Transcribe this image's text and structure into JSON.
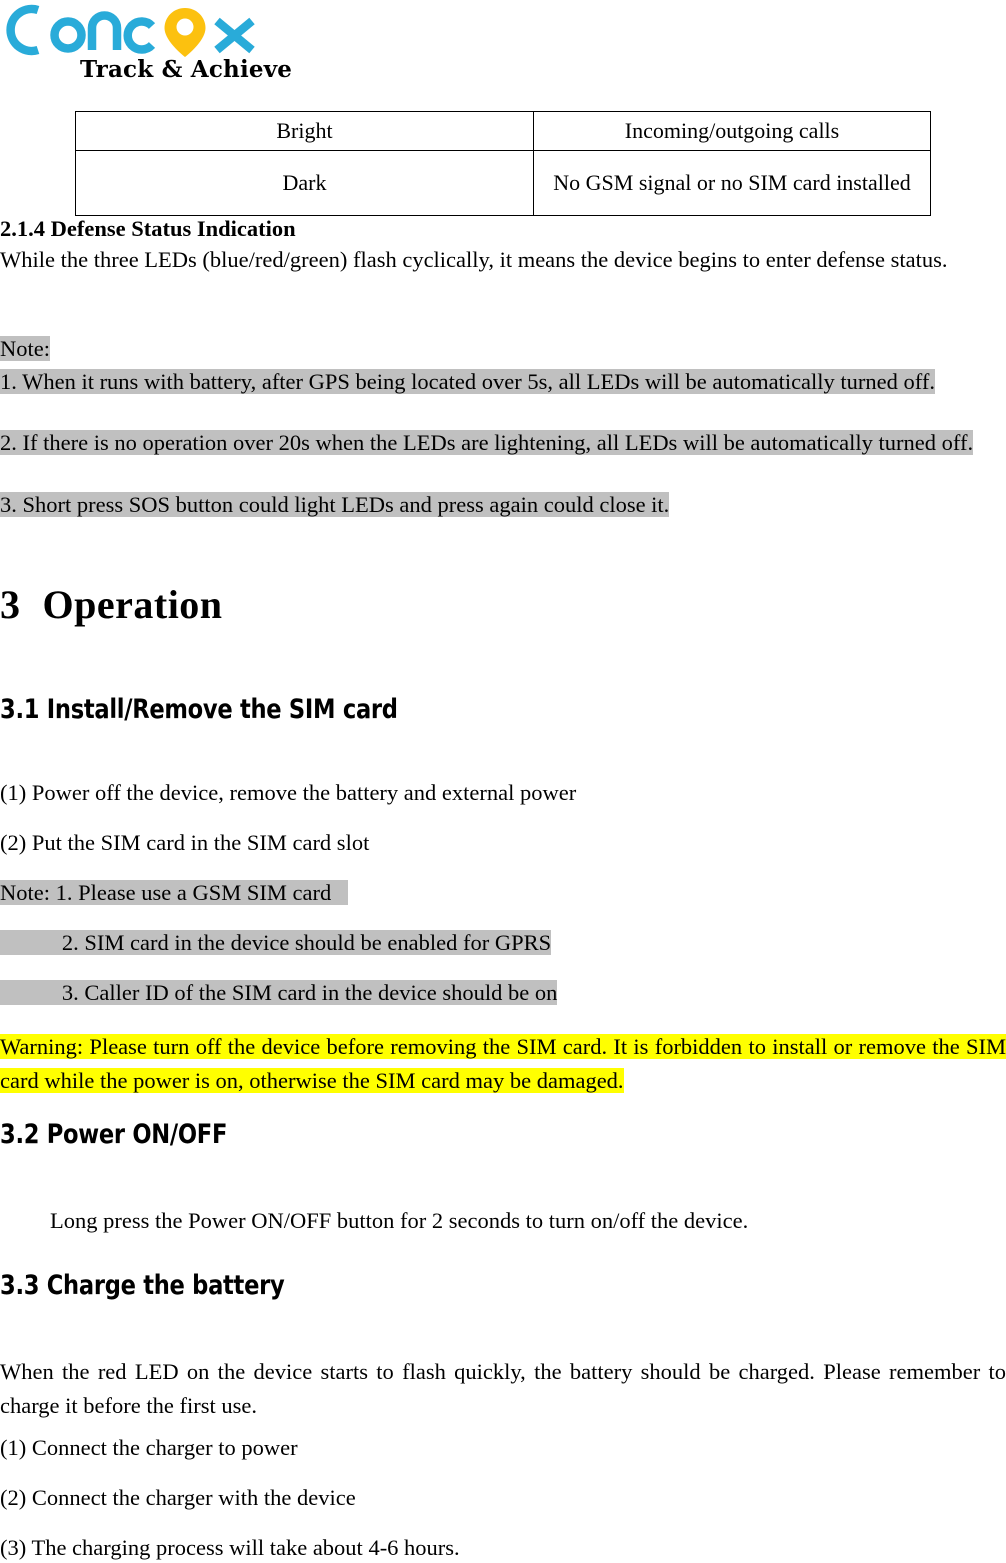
{
  "logo": {
    "wordmark": "Concox",
    "tagline": "Track & Achieve",
    "brand_color": "#29abd9",
    "pin_color": "#fcc10f",
    "pin_icon": "location-pin-icon"
  },
  "led_table": {
    "rows": [
      {
        "state": "Bright",
        "meaning": "Incoming/outgoing calls"
      },
      {
        "state": "Dark",
        "meaning": "No GSM signal or no SIM card installed"
      }
    ]
  },
  "section_214": {
    "heading": "2.1.4 Defense Status Indication",
    "body": "While the three LEDs (blue/red/green) flash cyclically, it means the device begins to enter defense status."
  },
  "defense_note": {
    "label": "Note:",
    "items": [
      "1. When it runs with battery, after GPS being located over 5s, all LEDs will be automatically turned off.",
      "2. If there is no operation over 20s when the LEDs are lightening, all LEDs will be automatically turned off.",
      "3. Short press SOS button could light LEDs and press again could close it.",
      "highlight_color: #c0c0c0"
    ],
    "item1": "1. When it runs with battery, after GPS being located over 5s, all LEDs will be automatically turned off.",
    "item2": "2. If there is no operation over 20s when the LEDs are lightening, all LEDs will be automatically turned off.",
    "item3": "3. Short press SOS button could light LEDs and press again could close it.",
    "highlight_color": "#c0c0c0"
  },
  "chapter3": {
    "number": "3",
    "title": "Operation"
  },
  "section_31": {
    "heading": "3.1  Install/Remove the SIM card",
    "step1": "(1) Power off the device, remove the battery and external power",
    "step2": "(2) Put the SIM card in the SIM card slot",
    "note1": "Note: 1. Please use a GSM SIM card",
    "note2": "2. SIM card in the device should be enabled for GPRS",
    "note3": "3. Caller ID of the SIM card in the device should be on",
    "warning": "Warning: Please turn off the device before removing the SIM card. It is forbidden to install or remove the SIM card while the power is on, otherwise the SIM card may be damaged.",
    "warning_highlight_color": "#ffff00"
  },
  "section_32": {
    "heading": "3.2  Power ON/OFF",
    "body": "Long press the Power ON/OFF button for 2 seconds to turn on/off the device."
  },
  "section_33": {
    "heading": "3.3  Charge the battery",
    "body": "When the red LED on the device starts to flash quickly, the battery should be charged. Please remember to charge it before the first use.",
    "step1": "(1) Connect the charger to power",
    "step2": "(2) Connect the charger with the device",
    "step3": "(3) The charging process will take about 4-6 hours."
  }
}
